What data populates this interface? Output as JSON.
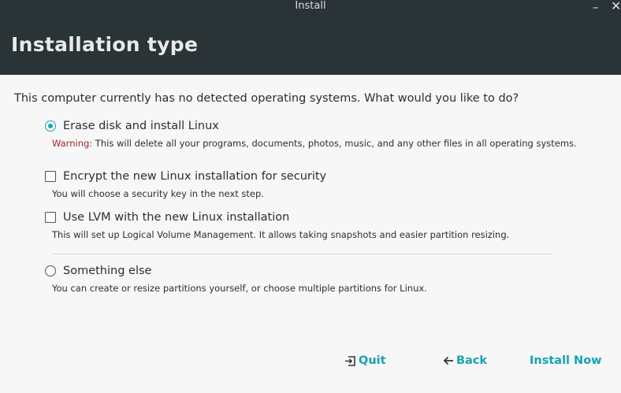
{
  "window": {
    "title": "Install",
    "minimize_icon": "minimize-icon",
    "close_icon": "close-icon"
  },
  "header": {
    "title": "Installation type"
  },
  "question": "This computer currently has no detected operating systems. What would you like to do?",
  "options": {
    "erase": {
      "label": "Erase disk and install Linux",
      "type": "radio",
      "checked": true,
      "warning_label": "Warning:",
      "warning_text": " This will delete all your programs, documents, photos, music, and any other files in all operating systems."
    },
    "encrypt": {
      "label": "Encrypt the new Linux installation for security",
      "type": "checkbox",
      "checked": false,
      "description": "You will choose a security key in the next step."
    },
    "lvm": {
      "label": "Use LVM with the new Linux installation",
      "type": "checkbox",
      "checked": false,
      "description": "This will set up Logical Volume Management. It allows taking snapshots and easier partition resizing."
    },
    "something_else": {
      "label": "Something else",
      "type": "radio",
      "checked": false,
      "description": "You can create or resize partitions yourself, or choose multiple partitions for Linux."
    }
  },
  "buttons": {
    "quit": {
      "label": "Quit",
      "icon": "quit-icon"
    },
    "back": {
      "label": "Back",
      "icon": "arrow-left-icon"
    },
    "install": {
      "label": "Install Now"
    }
  },
  "colors": {
    "accent": "#16a3b3",
    "header_bg": "#2a3336",
    "warning": "#a32525"
  }
}
